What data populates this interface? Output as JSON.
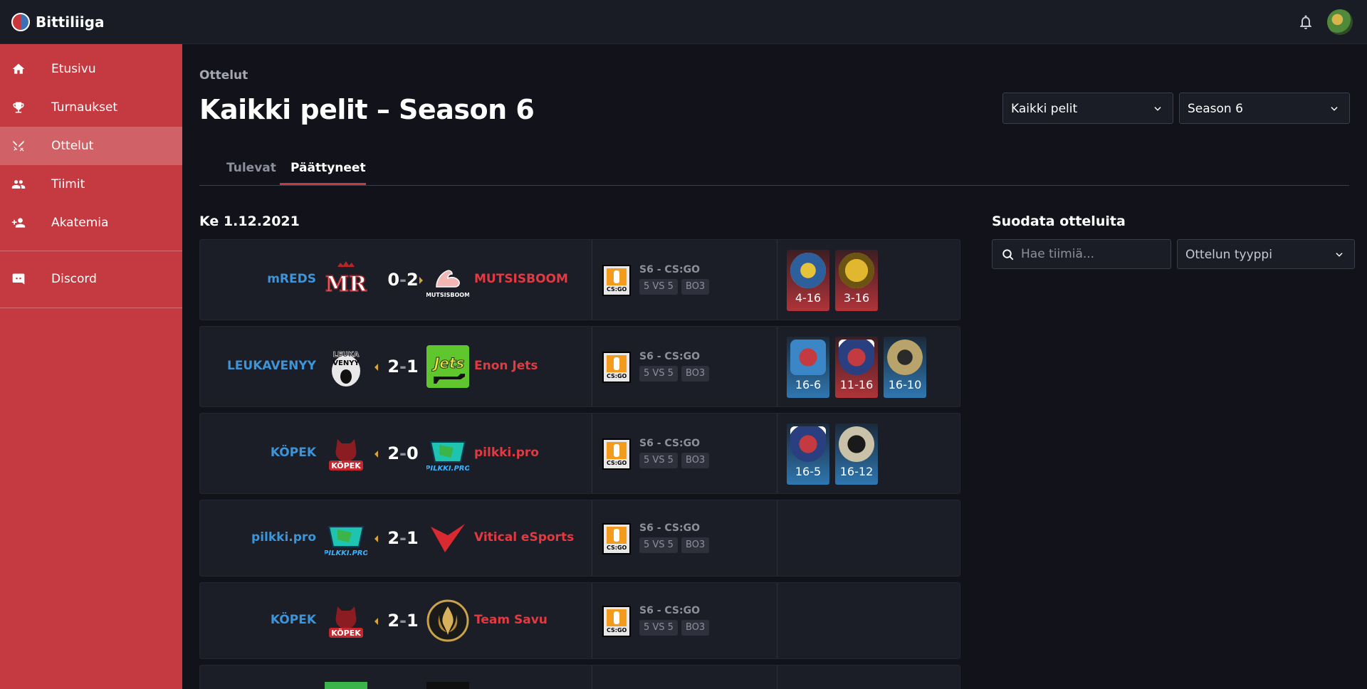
{
  "app": {
    "name": "Bittiliiga"
  },
  "sidebar": {
    "items": [
      {
        "label": "Etusivu",
        "icon": "home-icon"
      },
      {
        "label": "Turnaukset",
        "icon": "trophy-icon"
      },
      {
        "label": "Ottelut",
        "icon": "swords-icon",
        "active": true
      },
      {
        "label": "Tiimit",
        "icon": "people-icon"
      },
      {
        "label": "Akatemia",
        "icon": "person-add-icon"
      },
      {
        "label": "Discord",
        "icon": "discord-icon"
      }
    ]
  },
  "header": {
    "breadcrumb": "Ottelut",
    "title": "Kaikki pelit – Season 6",
    "game_select": "Kaikki pelit",
    "season_select": "Season 6"
  },
  "tabs": [
    {
      "label": "Tulevat"
    },
    {
      "label": "Päättyneet",
      "active": true
    }
  ],
  "matches": {
    "date": "Ke 1.12.2021",
    "rows": [
      {
        "team_a": "mREDS",
        "score_a": "0",
        "score_b": "2",
        "team_b": "MUTSISBOOM",
        "league": "S6 - CS:GO",
        "format": "5 VS 5",
        "series": "BO3",
        "maps": [
          {
            "score": "4-16",
            "result": "loss"
          },
          {
            "score": "3-16",
            "result": "loss"
          }
        ]
      },
      {
        "team_a": "LEUKAVENYY",
        "score_a": "2",
        "score_b": "1",
        "team_b": "Enon Jets",
        "league": "S6 - CS:GO",
        "format": "5 VS 5",
        "series": "BO3",
        "maps": [
          {
            "score": "16-6",
            "result": "win"
          },
          {
            "score": "11-16",
            "result": "loss"
          },
          {
            "score": "16-10",
            "result": "win"
          }
        ]
      },
      {
        "team_a": "KÖPEK",
        "score_a": "2",
        "score_b": "0",
        "team_b": "pilkki.pro",
        "league": "S6 - CS:GO",
        "format": "5 VS 5",
        "series": "BO3",
        "maps": [
          {
            "score": "16-5",
            "result": "win"
          },
          {
            "score": "16-12",
            "result": "win"
          }
        ]
      },
      {
        "team_a": "pilkki.pro",
        "score_a": "2",
        "score_b": "1",
        "team_b": "Vitical eSports",
        "league": "S6 - CS:GO",
        "format": "5 VS 5",
        "series": "BO3",
        "maps": []
      },
      {
        "team_a": "KÖPEK",
        "score_a": "2",
        "score_b": "1",
        "team_b": "Team Savu",
        "league": "S6 - CS:GO",
        "format": "5 VS 5",
        "series": "BO3",
        "maps": []
      }
    ]
  },
  "game_icon_label": "CS:GO",
  "filter": {
    "title": "Suodata otteluita",
    "search_placeholder": "Hae tiimiä...",
    "type_select": "Ottelun tyyppi"
  },
  "colors": {
    "accent": "#c53a40",
    "team_a": "#3d95d9",
    "team_b": "#e23a40",
    "background": "#12131a"
  }
}
